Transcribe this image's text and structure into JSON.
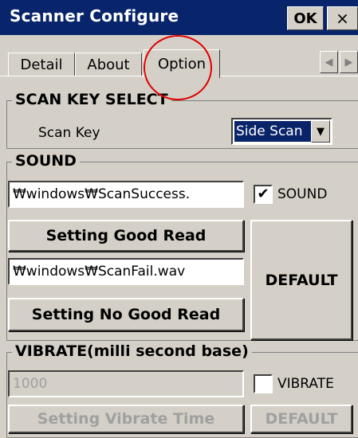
{
  "window": {
    "title": "Scanner Configure",
    "ok_label": "OK",
    "close_label": "×"
  },
  "tabs": [
    {
      "label": "Detail"
    },
    {
      "label": "About"
    },
    {
      "label": "Option"
    }
  ],
  "tab_scroll": {
    "left": "◀",
    "right": "▶"
  },
  "scan_key": {
    "title": "SCAN KEY SELECT",
    "label": "Scan Key",
    "value": "Side Scan",
    "arrow": "▼"
  },
  "sound": {
    "title": "SOUND",
    "success_path": "₩windows₩ScanSuccess.",
    "fail_path": "₩windows₩ScanFail.wav",
    "checkbox_label": "SOUND",
    "checkbox_checked": true,
    "check_mark": "✔",
    "good_read_button": "Setting Good Read",
    "no_good_read_button": "Setting No Good Read",
    "default_button": "DEFAULT"
  },
  "vibrate": {
    "title": "VIBRATE(milli second base)",
    "value": "1000",
    "checkbox_label": "VIBRATE",
    "checkbox_checked": false,
    "set_button": "Setting Vibrate Time",
    "default_button": "DEFAULT"
  },
  "colors": {
    "titlebar": "#08246b",
    "highlight_circle": "#e00000",
    "face": "#d4d0c8"
  }
}
